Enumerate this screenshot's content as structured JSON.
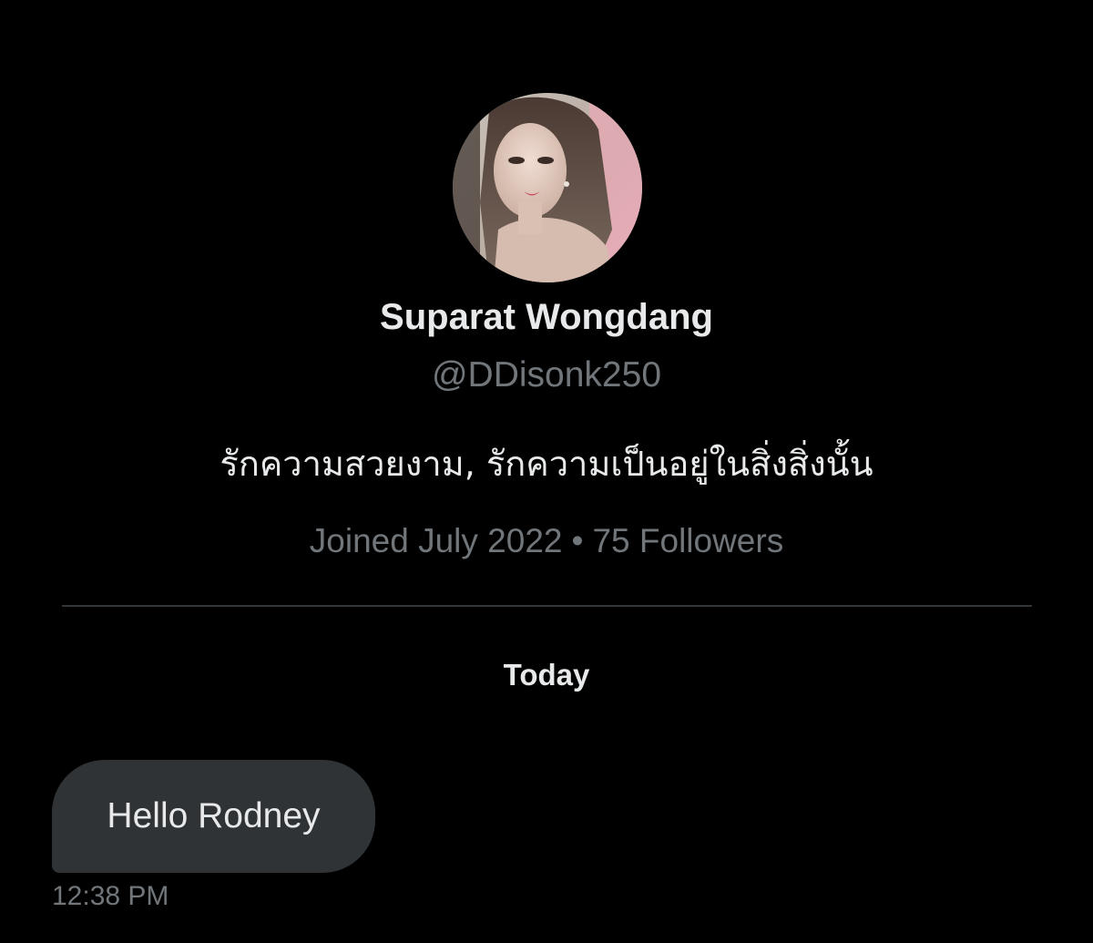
{
  "profile": {
    "display_name": "Suparat Wongdang",
    "handle": "@DDisonk250",
    "bio": "รักความสวยงาม, รักความเป็นอยู่ในสิ่งสิ่งนั้น",
    "joined": "Joined July 2022",
    "separator": "•",
    "followers": "75 Followers"
  },
  "conversation": {
    "day_label": "Today",
    "messages": [
      {
        "text": "Hello Rodney",
        "time": "12:38 PM"
      }
    ]
  },
  "colors": {
    "background": "#000000",
    "primary_text": "#e7e9ea",
    "secondary_text": "#71767b",
    "bubble": "#2f3336",
    "divider": "#333639"
  }
}
